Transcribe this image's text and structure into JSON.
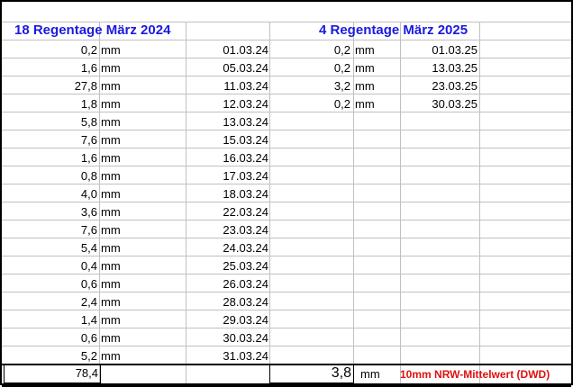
{
  "left": {
    "title": "18 Regentage März 2024",
    "rows": [
      {
        "value": "0,2",
        "unit": "mm",
        "date": "01.03.24"
      },
      {
        "value": "1,6",
        "unit": "mm",
        "date": "05.03.24"
      },
      {
        "value": "27,8",
        "unit": "mm",
        "date": "11.03.24"
      },
      {
        "value": "1,8",
        "unit": "mm",
        "date": "12.03.24"
      },
      {
        "value": "5,8",
        "unit": "mm",
        "date": "13.03.24"
      },
      {
        "value": "7,6",
        "unit": "mm",
        "date": "15.03.24"
      },
      {
        "value": "1,6",
        "unit": "mm",
        "date": "16.03.24"
      },
      {
        "value": "0,8",
        "unit": "mm",
        "date": "17.03.24"
      },
      {
        "value": "4,0",
        "unit": "mm",
        "date": "18.03.24"
      },
      {
        "value": "3,6",
        "unit": "mm",
        "date": "22.03.24"
      },
      {
        "value": "7,6",
        "unit": "mm",
        "date": "23.03.24"
      },
      {
        "value": "5,4",
        "unit": "mm",
        "date": "24.03.24"
      },
      {
        "value": "0,4",
        "unit": "mm",
        "date": "25.03.24"
      },
      {
        "value": "0,6",
        "unit": "mm",
        "date": "26.03.24"
      },
      {
        "value": "2,4",
        "unit": "mm",
        "date": "28.03.24"
      },
      {
        "value": "1,4",
        "unit": "mm",
        "date": "29.03.24"
      },
      {
        "value": "0,6",
        "unit": "mm",
        "date": "30.03.24"
      },
      {
        "value": "5,2",
        "unit": "mm",
        "date": "31.03.24"
      }
    ],
    "total": "78,4"
  },
  "right": {
    "title": "4 Regentage März 2025",
    "rows": [
      {
        "value": "0,2",
        "unit": "mm",
        "date": "01.03.25"
      },
      {
        "value": "0,2",
        "unit": "mm",
        "date": "13.03.25"
      },
      {
        "value": "3,2",
        "unit": "mm",
        "date": "23.03.25"
      },
      {
        "value": "0,2",
        "unit": "mm",
        "date": "30.03.25"
      }
    ],
    "total": "3,8",
    "total_unit": "mm",
    "note": "10mm NRW-Mittelwert (DWD)"
  }
}
